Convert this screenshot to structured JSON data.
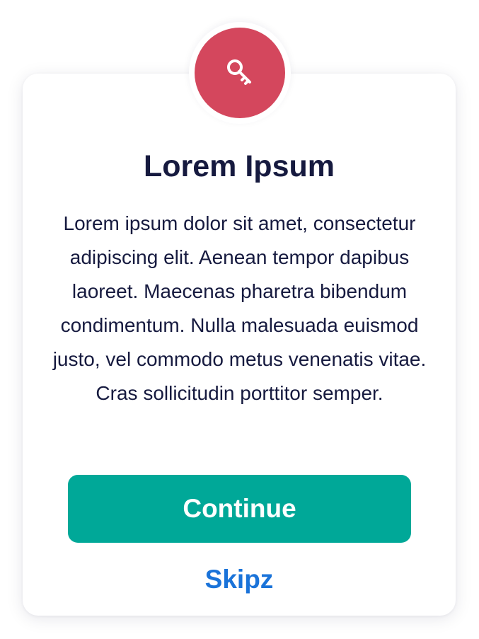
{
  "dialog": {
    "icon": "key-icon",
    "title": "Lorem Ipsum",
    "body": "Lorem ipsum dolor sit amet, consectetur adipiscing elit. Aenean tempor dapibus laoreet. Maecenas pharetra bibendum condimentum. Nulla malesuada euismod justo, vel commodo metus venenatis vitae. Cras sollicitudin porttitor semper.",
    "primary_button_label": "Continue",
    "secondary_link_label": "Skipz"
  },
  "colors": {
    "badge": "#d4475d",
    "primary_button": "#00a898",
    "link": "#1a73d9",
    "text": "#161a3f"
  }
}
